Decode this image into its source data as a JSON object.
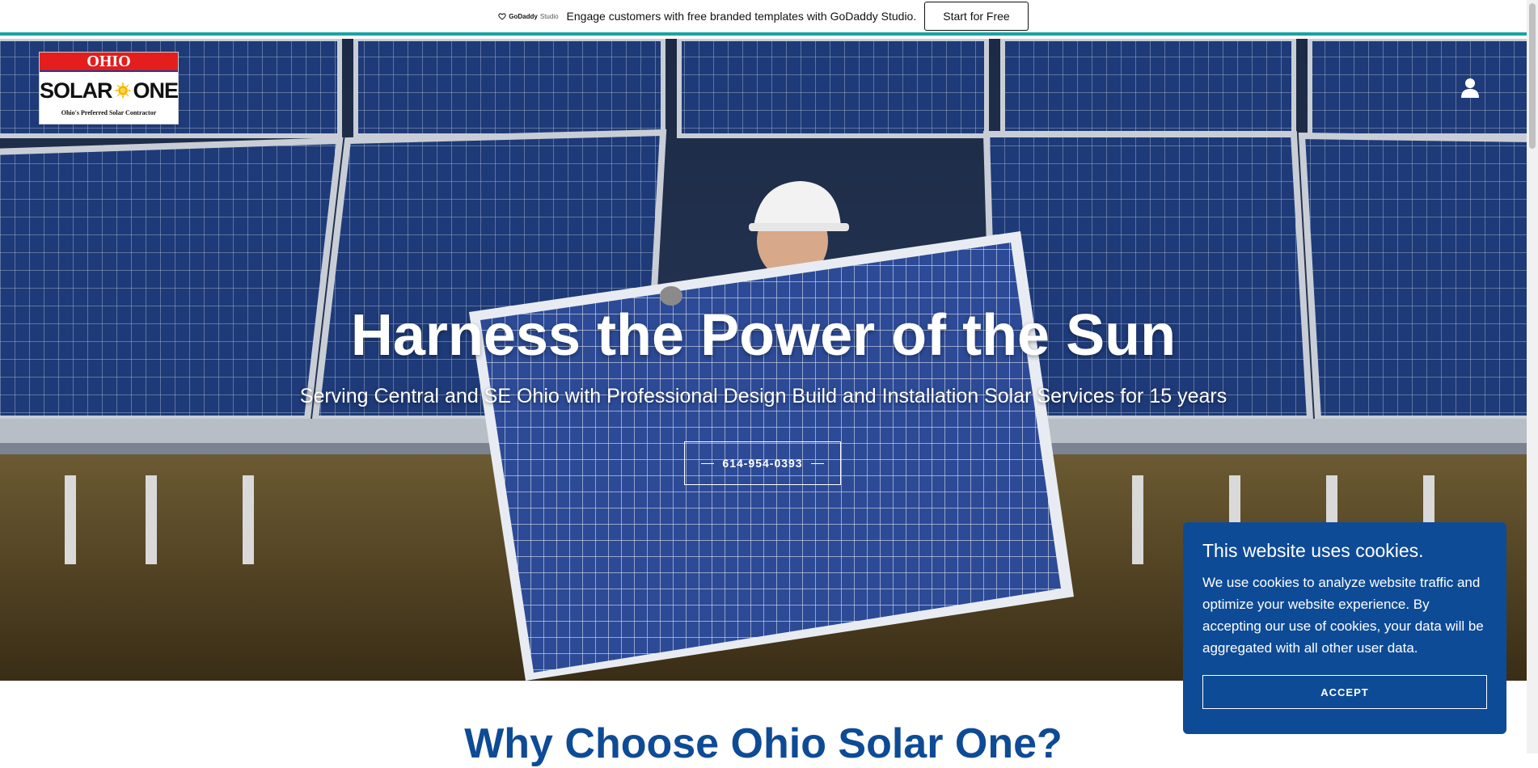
{
  "promo": {
    "logo_text": "GoDaddy",
    "logo_sub": "Studio",
    "text": "Engage customers with free branded templates with GoDaddy Studio.",
    "button_label": "Start for Free"
  },
  "brand": {
    "top": "OHIO",
    "left": "SOLAR",
    "right": "ONE",
    "tagline": "Ohio's Preferred Solar Contractor"
  },
  "hero": {
    "title": "Harness the Power of the Sun",
    "subtitle": "Serving Central and SE Ohio with Professional Design Build and Installation Solar Services for 15 years",
    "phone": "614-954-0393"
  },
  "section": {
    "title": "Why Choose Ohio Solar One?"
  },
  "cookie": {
    "title": "This website uses cookies.",
    "body": "We use cookies to analyze website traffic and optimize your website experience. By accepting our use of cookies, your data will be aggregated with all other user data.",
    "accept_label": "ACCEPT"
  },
  "colors": {
    "accent": "#1aa3a3",
    "brand_blue": "#0e4b96",
    "logo_red": "#e41d1d"
  },
  "icons": [
    "godaddy-logo-icon",
    "user-icon",
    "sun-icon"
  ]
}
